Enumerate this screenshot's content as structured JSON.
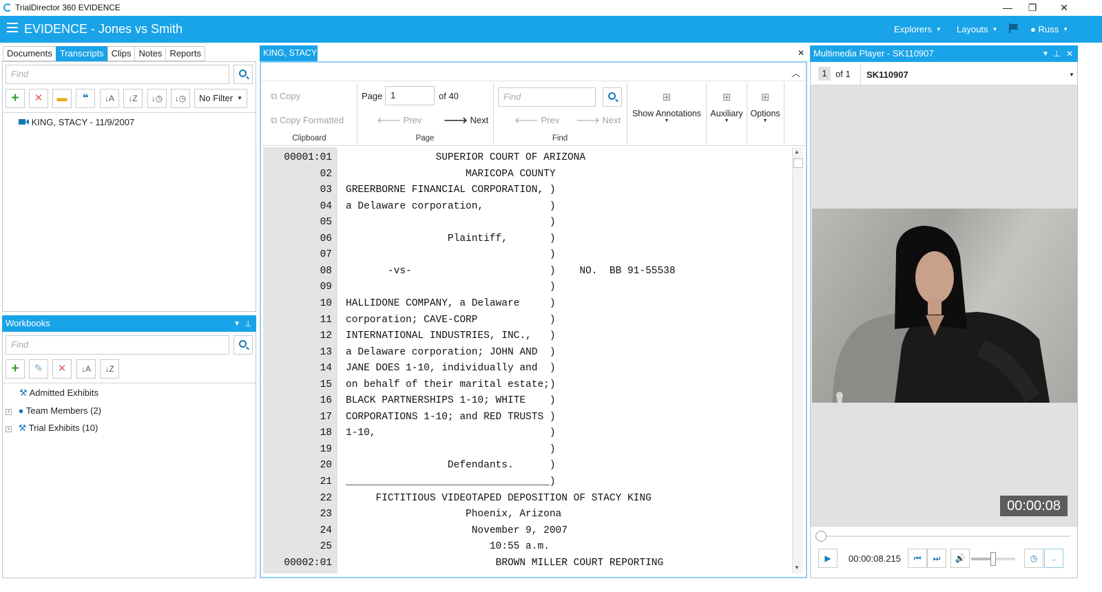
{
  "window": {
    "title": "TrialDirector 360 EVIDENCE",
    "minimize": "—",
    "maximize": "❐",
    "close": "✕"
  },
  "app": {
    "title": "EVIDENCE - Jones vs Smith",
    "explorers": "Explorers",
    "layouts": "Layouts",
    "user": "Russ"
  },
  "left": {
    "tabs": [
      "Documents",
      "Transcripts",
      "Clips",
      "Notes",
      "Reports"
    ],
    "find_placeholder": "Find",
    "filter": "No Filter",
    "tree_item": "KING, STACY - 11/9/2007"
  },
  "workbooks": {
    "header": "Workbooks",
    "find_placeholder": "Find",
    "items": [
      "Admitted Exhibits",
      "Team Members (2)",
      "Trial Exhibits (10)"
    ]
  },
  "viewer": {
    "tab": "KING, STACY",
    "ribbon": {
      "copy": "Copy",
      "copy_formatted": "Copy Formatted",
      "clipboard": "Clipboard",
      "page_label": "Page",
      "page_value": "1",
      "page_of": "of 40",
      "prev": "Prev",
      "next": "Next",
      "page_group": "Page",
      "find_placeholder": "Find",
      "find_prev": "Prev",
      "find_next": "Next",
      "find_group": "Find",
      "show_annotations": "Show Annotations",
      "auxiliary": "Auxiliary",
      "options": "Options"
    },
    "lines": [
      {
        "n": "00001:01",
        "t": "               SUPERIOR COURT OF ARIZONA"
      },
      {
        "n": "02",
        "t": "                    MARICOPA COUNTY"
      },
      {
        "n": "03",
        "t": "GREERBORNE FINANCIAL CORPORATION, )"
      },
      {
        "n": "04",
        "t": "a Delaware corporation,           )"
      },
      {
        "n": "05",
        "t": "                                  )"
      },
      {
        "n": "06",
        "t": "                 Plaintiff,       )"
      },
      {
        "n": "07",
        "t": "                                  )"
      },
      {
        "n": "08",
        "t": "       -vs-                       )    NO.  BB 91-55538"
      },
      {
        "n": "09",
        "t": "                                  )"
      },
      {
        "n": "10",
        "t": "HALLIDONE COMPANY, a Delaware     )"
      },
      {
        "n": "11",
        "t": "corporation; CAVE-CORP            )"
      },
      {
        "n": "12",
        "t": "INTERNATIONAL INDUSTRIES, INC.,   )"
      },
      {
        "n": "13",
        "t": "a Delaware corporation; JOHN AND  )"
      },
      {
        "n": "14",
        "t": "JANE DOES 1-10, individually and  )"
      },
      {
        "n": "15",
        "t": "on behalf of their marital estate;)"
      },
      {
        "n": "16",
        "t": "BLACK PARTNERSHIPS 1-10; WHITE    )"
      },
      {
        "n": "17",
        "t": "CORPORATIONS 1-10; and RED TRUSTS )"
      },
      {
        "n": "18",
        "t": "1-10,                             )"
      },
      {
        "n": "19",
        "t": "                                  )"
      },
      {
        "n": "20",
        "t": "                 Defendants.      )"
      },
      {
        "n": "21",
        "t": "__________________________________)"
      },
      {
        "n": "22",
        "t": "     FICTITIOUS VIDEOTAPED DEPOSITION OF STACY KING"
      },
      {
        "n": "23",
        "t": "                    Phoenix, Arizona"
      },
      {
        "n": "24",
        "t": "                     November 9, 2007"
      },
      {
        "n": "25",
        "t": "                        10:55 a.m."
      },
      {
        "n": "00002:01",
        "t": "                         BROWN MILLER COURT REPORTING"
      }
    ]
  },
  "player": {
    "header": "Multimedia Player - SK110907",
    "page": "1",
    "of": "of 1",
    "clip": "SK110907",
    "overlay_time": "00:00:08",
    "time": "00:00:08.215",
    "progress": 0.01,
    "volume": 0.5
  }
}
